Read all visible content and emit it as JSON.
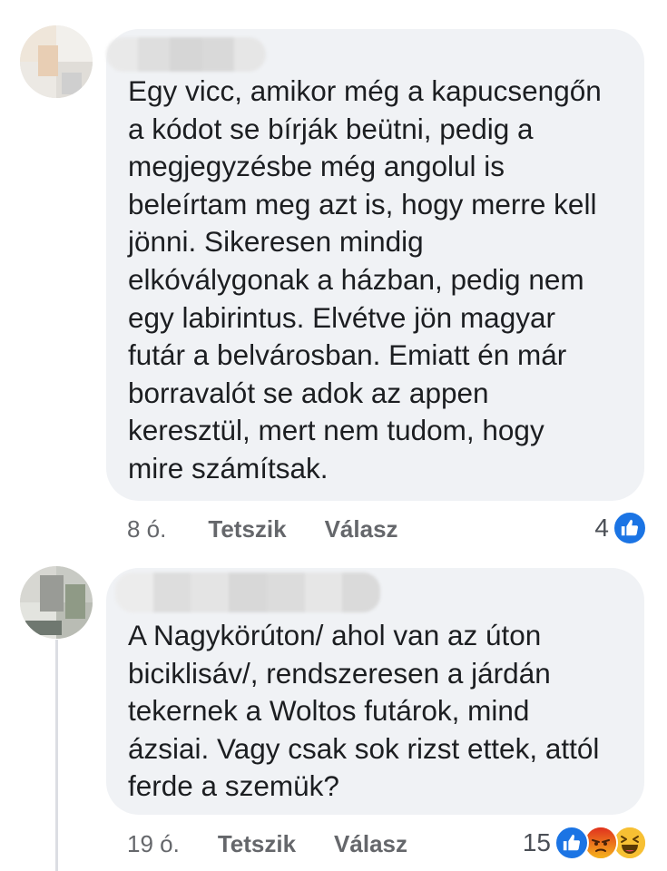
{
  "comments": [
    {
      "text": "Egy vicc, amikor még a kapucsengőn\na kódot se bírják beütni, pedig a\nmegjegyzésbe még angolul is\nbeleírtam meg azt is, hogy merre kell\njönni. Sikeresen mindig\nelkóválygonak a házban, pedig nem\negy labirintus. Elvétve jön magyar\nfutár a belvárosban. Emiatt én már\nborravalót se adok az appen\nkeresztül, mert nem tudom, hogy\nmire számítsak.",
      "time": "8 ó.",
      "like_label": "Tetszik",
      "reply_label": "Válasz",
      "reaction_count": "4",
      "reactions": [
        "like-icon"
      ]
    },
    {
      "text": "A Nagykörúton/ ahol van az úton\nbiciklisáv/, rendszeresen a járdán\ntekernek a Woltos futárok, mind\názsiai. Vagy csak sok rizst ettek, attól\nferde a szemük?",
      "time": "19 ó.",
      "like_label": "Tetszik",
      "reply_label": "Válasz",
      "reaction_count": "15",
      "reactions": [
        "like-icon",
        "angry-icon",
        "haha-icon"
      ]
    }
  ],
  "colors": {
    "bubble": "#f0f2f5",
    "like_blue": "#1b74e4",
    "meta_gray": "#65676b",
    "angry": "#e9710f",
    "haha": "#f7b125"
  }
}
